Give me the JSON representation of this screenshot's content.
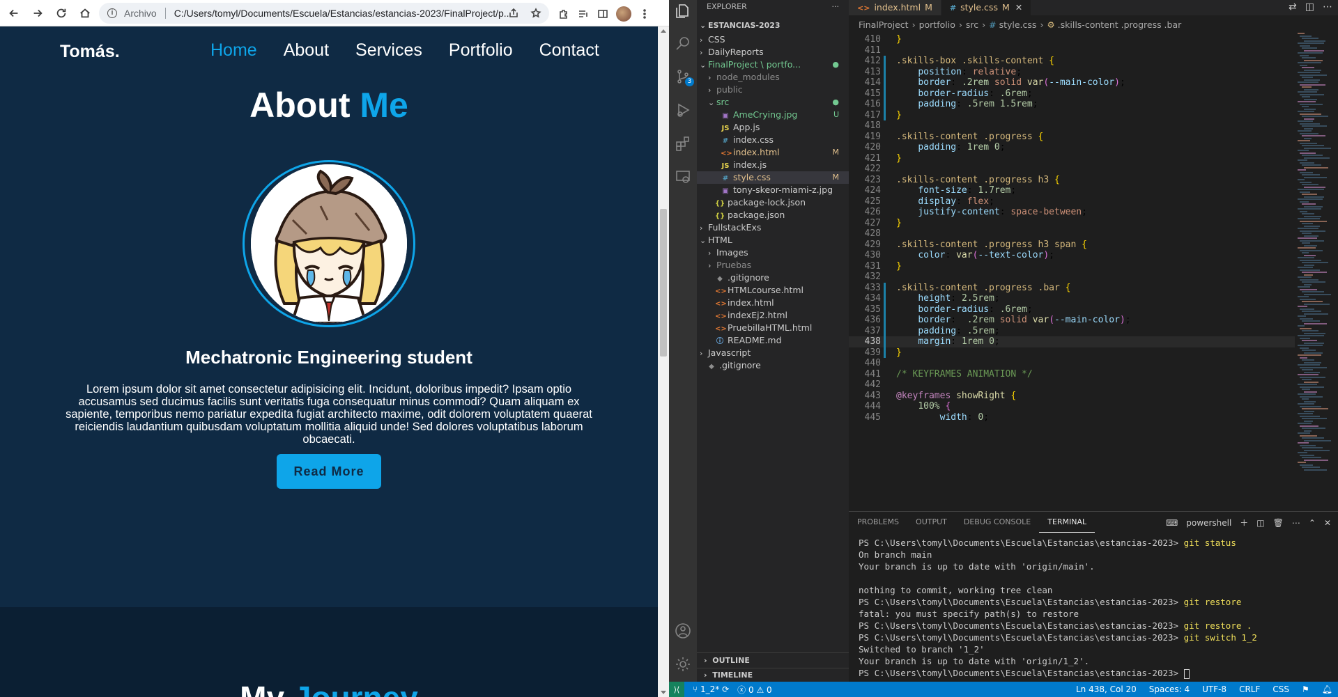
{
  "browser": {
    "scheme": "Archivo",
    "url": "C:/Users/tomyl/Documents/Escuela/Estancias/estancias-2023/FinalProject/p..."
  },
  "site": {
    "logo": "Tomás.",
    "nav": [
      "Home",
      "About",
      "Services",
      "Portfolio",
      "Contact"
    ],
    "active_nav": "Home",
    "about_title_a": "About",
    "about_title_b": "Me",
    "subtitle": "Mechatronic Engineering student",
    "about_text": "Lorem ipsum dolor sit amet consectetur adipisicing elit. Incidunt, doloribus impedit? Ipsam optio accusamus sed ducimus facilis sunt veritatis fuga consequatur minus commodi? Quam aliquam ex sapiente, temporibus nemo pariatur expedita fugiat architecto maxime, odit dolorem voluptatem quaerat reiciendis laudantium quibusdam voluptatum mollitia aliquid unde! Sed dolores voluptatibus laborum obcaecati.",
    "read_more": "Read More",
    "journey_a": "My",
    "journey_b": "Journey"
  },
  "vscode": {
    "explorer_title": "EXPLORER",
    "explorer_dots": "···",
    "root": "ESTANCIAS-2023",
    "tree": [
      {
        "label": "CSS",
        "type": "folder-closed",
        "depth": 1
      },
      {
        "label": "DailyReports",
        "type": "folder-closed",
        "depth": 1
      },
      {
        "label": "FinalProject \\ portfo...",
        "type": "folder-open",
        "depth": 1,
        "status": "●",
        "color": "untr"
      },
      {
        "label": "node_modules",
        "type": "folder-closed",
        "depth": 2,
        "color": "dimf"
      },
      {
        "label": "public",
        "type": "folder-closed",
        "depth": 2,
        "color": "dimf"
      },
      {
        "label": "src",
        "type": "folder-open",
        "depth": 2,
        "status": "●",
        "color": "untr"
      },
      {
        "label": "AmeCrying.jpg",
        "type": "img",
        "depth": 3,
        "status": "U",
        "color": "untr"
      },
      {
        "label": "App.js",
        "type": "js",
        "depth": 3
      },
      {
        "label": "index.css",
        "type": "css",
        "depth": 3
      },
      {
        "label": "index.html",
        "type": "html",
        "depth": 3,
        "status": "M",
        "color": "mod"
      },
      {
        "label": "index.js",
        "type": "js",
        "depth": 3
      },
      {
        "label": "style.css",
        "type": "css",
        "depth": 3,
        "status": "M",
        "color": "mod",
        "selected": true
      },
      {
        "label": "tony-skeor-miami-z.jpg",
        "type": "img",
        "depth": 3
      },
      {
        "label": "package-lock.json",
        "type": "json",
        "depth": 2
      },
      {
        "label": "package.json",
        "type": "json",
        "depth": 2
      },
      {
        "label": "FullstackExs",
        "type": "folder-closed",
        "depth": 1
      },
      {
        "label": "HTML",
        "type": "folder-open",
        "depth": 1
      },
      {
        "label": "Images",
        "type": "folder-closed",
        "depth": 2
      },
      {
        "label": "Pruebas",
        "type": "folder-closed",
        "depth": 2,
        "color": "dimf"
      },
      {
        "label": ".gitignore",
        "type": "git",
        "depth": 2
      },
      {
        "label": "HTMLcourse.html",
        "type": "html",
        "depth": 2
      },
      {
        "label": "index.html",
        "type": "html",
        "depth": 2
      },
      {
        "label": "indexEj2.html",
        "type": "html",
        "depth": 2
      },
      {
        "label": "PruebillaHTML.html",
        "type": "html",
        "depth": 2
      },
      {
        "label": "README.md",
        "type": "info",
        "depth": 2
      },
      {
        "label": "Javascript",
        "type": "folder-closed",
        "depth": 1
      },
      {
        "label": ".gitignore",
        "type": "git",
        "depth": 1
      }
    ],
    "outline": "OUTLINE",
    "timeline": "TIMELINE",
    "tabs": [
      {
        "label": "index.html",
        "mod": "M",
        "icon": "<>",
        "active": false
      },
      {
        "label": "style.css",
        "mod": "M",
        "icon": "#",
        "active": true
      }
    ],
    "breadcrumb": [
      "FinalProject",
      "portfolio",
      "src",
      "style.css",
      ".skills-content .progress .bar"
    ],
    "code_start": 410,
    "code": [
      [
        [
          "br",
          "}"
        ]
      ],
      [],
      [
        [
          "sel",
          ".skills-box .skills-content "
        ],
        [
          "br",
          "{"
        ]
      ],
      [
        [
          "ind",
          "    "
        ],
        [
          "prop",
          "position"
        ],
        [
          "p",
          ": "
        ],
        [
          "kw",
          "relative"
        ],
        [
          "p",
          ";"
        ]
      ],
      [
        [
          "ind",
          "    "
        ],
        [
          "prop",
          "border"
        ],
        [
          "p",
          ": "
        ],
        [
          "num",
          ".2rem"
        ],
        [
          "p",
          " "
        ],
        [
          "kw",
          "solid"
        ],
        [
          "p",
          " "
        ],
        [
          "fn",
          "var"
        ],
        [
          "br2",
          "("
        ],
        [
          "var",
          "--main-color"
        ],
        [
          "br2",
          ")"
        ],
        [
          "p",
          ";"
        ]
      ],
      [
        [
          "ind",
          "    "
        ],
        [
          "prop",
          "border-radius"
        ],
        [
          "p",
          ": "
        ],
        [
          "num",
          ".6rem"
        ],
        [
          "p",
          ";"
        ]
      ],
      [
        [
          "ind",
          "    "
        ],
        [
          "prop",
          "padding"
        ],
        [
          "p",
          ": "
        ],
        [
          "num",
          ".5rem 1.5rem"
        ],
        [
          "p",
          ";"
        ]
      ],
      [
        [
          "br",
          "}"
        ]
      ],
      [],
      [
        [
          "sel",
          ".skills-content .progress "
        ],
        [
          "br",
          "{"
        ]
      ],
      [
        [
          "ind",
          "    "
        ],
        [
          "prop",
          "padding"
        ],
        [
          "p",
          ": "
        ],
        [
          "num",
          "1rem 0"
        ],
        [
          "p",
          ";"
        ]
      ],
      [
        [
          "br",
          "}"
        ]
      ],
      [],
      [
        [
          "sel",
          ".skills-content .progress h3 "
        ],
        [
          "br",
          "{"
        ]
      ],
      [
        [
          "ind",
          "    "
        ],
        [
          "prop",
          "font-size"
        ],
        [
          "p",
          ": "
        ],
        [
          "num",
          "1.7rem"
        ],
        [
          "p",
          ";"
        ]
      ],
      [
        [
          "ind",
          "    "
        ],
        [
          "prop",
          "display"
        ],
        [
          "p",
          ": "
        ],
        [
          "kw",
          "flex"
        ],
        [
          "p",
          ";"
        ]
      ],
      [
        [
          "ind",
          "    "
        ],
        [
          "prop",
          "justify-content"
        ],
        [
          "p",
          ": "
        ],
        [
          "kw",
          "space-between"
        ],
        [
          "p",
          ";"
        ]
      ],
      [
        [
          "br",
          "}"
        ]
      ],
      [],
      [
        [
          "sel",
          ".skills-content .progress h3 span "
        ],
        [
          "br",
          "{"
        ]
      ],
      [
        [
          "ind",
          "    "
        ],
        [
          "prop",
          "color"
        ],
        [
          "p",
          ": "
        ],
        [
          "fn",
          "var"
        ],
        [
          "br2",
          "("
        ],
        [
          "var",
          "--text-color"
        ],
        [
          "br2",
          ")"
        ],
        [
          "p",
          ";"
        ]
      ],
      [
        [
          "br",
          "}"
        ]
      ],
      [],
      [
        [
          "sel",
          ".skills-content .progress .bar "
        ],
        [
          "br",
          "{"
        ]
      ],
      [
        [
          "ind",
          "    "
        ],
        [
          "prop",
          "height"
        ],
        [
          "p",
          ": "
        ],
        [
          "num",
          "2.5rem"
        ],
        [
          "p",
          ";"
        ]
      ],
      [
        [
          "ind",
          "    "
        ],
        [
          "prop",
          "border-radius"
        ],
        [
          "p",
          ": "
        ],
        [
          "num",
          ".6rem"
        ],
        [
          "p",
          ";"
        ]
      ],
      [
        [
          "ind",
          "    "
        ],
        [
          "prop",
          "border"
        ],
        [
          "p",
          ":  "
        ],
        [
          "num",
          ".2rem"
        ],
        [
          "p",
          " "
        ],
        [
          "kw",
          "solid"
        ],
        [
          "p",
          " "
        ],
        [
          "fn",
          "var"
        ],
        [
          "br2",
          "("
        ],
        [
          "var",
          "--main-color"
        ],
        [
          "br2",
          ")"
        ],
        [
          "p",
          ";"
        ]
      ],
      [
        [
          "ind",
          "    "
        ],
        [
          "prop",
          "padding"
        ],
        [
          "p",
          ": "
        ],
        [
          "num",
          ".5rem"
        ],
        [
          "p",
          ";"
        ]
      ],
      [
        [
          "ind",
          "    "
        ],
        [
          "prop",
          "margin"
        ],
        [
          "p",
          ": "
        ],
        [
          "num",
          "1rem 0"
        ],
        [
          "p",
          ";"
        ]
      ],
      [
        [
          "br",
          "}"
        ]
      ],
      [],
      [
        [
          "cmt",
          "/* KEYFRAMES ANIMATION */"
        ]
      ],
      [],
      [
        [
          "at",
          "@keyframes"
        ],
        [
          "p",
          " "
        ],
        [
          "fn",
          "showRight"
        ],
        [
          "p",
          " "
        ],
        [
          "br",
          "{"
        ]
      ],
      [
        [
          "ind",
          "    "
        ],
        [
          "num",
          "100%"
        ],
        [
          "p",
          " "
        ],
        [
          "br2",
          "{"
        ]
      ],
      [
        [
          "ind",
          "        "
        ],
        [
          "prop",
          "width"
        ],
        [
          "p",
          ": "
        ],
        [
          "num",
          "0"
        ],
        [
          "p",
          ";"
        ]
      ]
    ],
    "current_line": 438,
    "panel_tabs": [
      "PROBLEMS",
      "OUTPUT",
      "DEBUG CONSOLE",
      "TERMINAL"
    ],
    "active_panel_tab": "TERMINAL",
    "shell": "powershell",
    "terminal": [
      {
        "prompt": "PS C:\\Users\\tomyl\\Documents\\Escuela\\Estancias\\estancias-2023> ",
        "cmd": "git status"
      },
      {
        "text": "On branch main"
      },
      {
        "text": "Your branch is up to date with 'origin/main'."
      },
      {
        "text": ""
      },
      {
        "text": "nothing to commit, working tree clean"
      },
      {
        "prompt": "PS C:\\Users\\tomyl\\Documents\\Escuela\\Estancias\\estancias-2023> ",
        "cmd": "git restore"
      },
      {
        "text": "fatal: you must specify path(s) to restore"
      },
      {
        "prompt": "PS C:\\Users\\tomyl\\Documents\\Escuela\\Estancias\\estancias-2023> ",
        "cmd": "git restore ."
      },
      {
        "prompt": "PS C:\\Users\\tomyl\\Documents\\Escuela\\Estancias\\estancias-2023> ",
        "cmd": "git switch 1_2"
      },
      {
        "text": "Switched to branch '1_2'"
      },
      {
        "text": "Your branch is up to date with 'origin/1_2'."
      },
      {
        "prompt": "PS C:\\Users\\tomyl\\Documents\\Escuela\\Estancias\\estancias-2023> ",
        "cmd": "",
        "cursor": true
      }
    ],
    "status": {
      "branch": "1_2*",
      "errors": "0",
      "warnings": "0",
      "position": "Ln 438, Col 20",
      "spaces": "Spaces: 4",
      "encoding": "UTF-8",
      "eol": "CRLF",
      "language": "CSS",
      "scm_badge": "3"
    }
  }
}
